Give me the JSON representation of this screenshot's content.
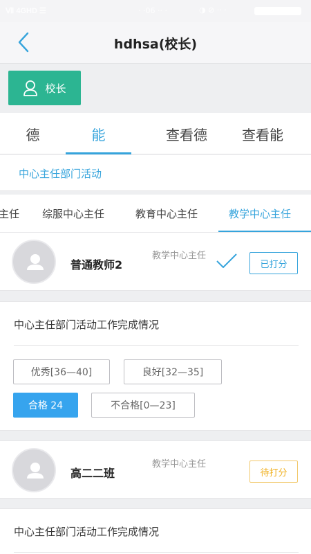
{
  "statusbar": {
    "left": "Ⅶ 4GHD ☰",
    "center": "· ·06 ·· ·",
    "right": "◑ ⊘ ·· ·"
  },
  "header": {
    "title": "hdhsa(校长)"
  },
  "role_button": {
    "label": "校长"
  },
  "tabs": [
    {
      "label": "德"
    },
    {
      "label": "能"
    },
    {
      "label": "查看德"
    },
    {
      "label": "查看能"
    }
  ],
  "section_label": "中心主任部门活动",
  "subtabs": [
    {
      "label": "主任"
    },
    {
      "label": "综服中心主任"
    },
    {
      "label": "教育中心主任"
    },
    {
      "label": "教学中心主任"
    }
  ],
  "entries": [
    {
      "name": "普通教师2",
      "dept": "教学中心主任",
      "status": "已打分",
      "item_title": "中心主任部门活动工作完成情况",
      "options": [
        "优秀[36—40]",
        "良好[32—35]",
        "合格 24",
        "不合格[0—23]"
      ]
    },
    {
      "name": "高二二班",
      "dept": "教学中心主任",
      "status": "待打分",
      "item_title": "中心主任部门活动工作完成情况"
    }
  ],
  "colors": {
    "accent": "#36a4dc",
    "role_button": "#2cb592",
    "pending": "#f0b020",
    "selected_option": "#36a4ee"
  }
}
